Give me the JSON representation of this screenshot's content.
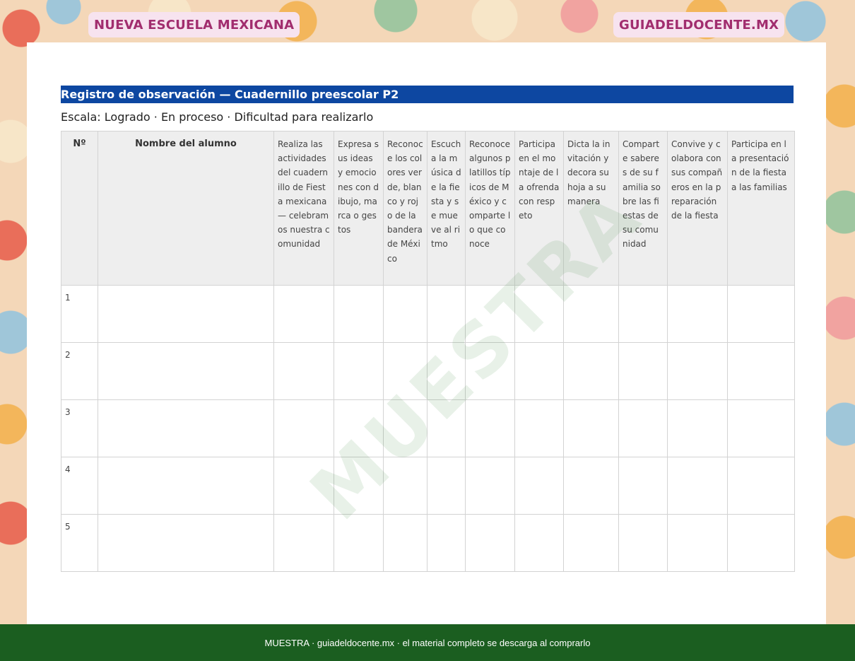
{
  "header": {
    "left_badge": "NUEVA ESCUELA MEXICANA",
    "right_badge": "GUIADELDOCENTE.MX"
  },
  "document": {
    "title": "Registro de observación — Cuadernillo preescolar P2",
    "scale": "Escala: Logrado · En proceso · Dificultad para realizarlo"
  },
  "table": {
    "headers": [
      "Nº",
      "Nombre del alumno",
      "Realiza las actividades del cuadernillo de Fiesta mexicana — celebramos nuestra comunidad",
      "Expresa sus ideas y emociones con dibujo, marca o gestos",
      "Reconoce los colores verde, blanco y rojo de la bandera de México",
      "Escucha la música de la fiesta y se mueve al ritmo",
      "Reconoce algunos platillos típicos de México y comparte lo que conoce",
      "Participa en el montaje de la ofrenda con respeto",
      "Dicta la invitación y decora su hoja a su manera",
      "Comparte saberes de su familia sobre las fiestas de su comunidad",
      "Convive y colabora con sus compañeros en la preparación de la fiesta",
      "Participa en la presentación de la fiesta a las familias"
    ],
    "rows": [
      "1",
      "2",
      "3",
      "4",
      "5"
    ]
  },
  "watermark": "MUESTRA",
  "footer": {
    "text": "MUESTRA · guiadeldocente.mx · el material completo se descarga al comprarlo"
  }
}
